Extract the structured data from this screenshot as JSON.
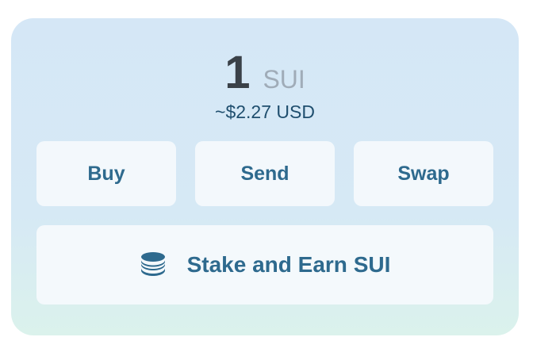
{
  "balance": {
    "amount": "1",
    "unit": "SUI",
    "usd": "~$2.27 USD"
  },
  "actions": {
    "buy_label": "Buy",
    "send_label": "Send",
    "swap_label": "Swap"
  },
  "stake": {
    "label": "Stake and Earn SUI",
    "icon": "coins-stack-icon"
  },
  "colors": {
    "card_gradient_top": "#d5e7f6",
    "card_gradient_bottom": "#dbf2ec",
    "accent_text": "#2e6a8e",
    "amount_text": "#3a4148",
    "unit_text": "#a0acb8",
    "button_background": "#f3f8fc"
  }
}
